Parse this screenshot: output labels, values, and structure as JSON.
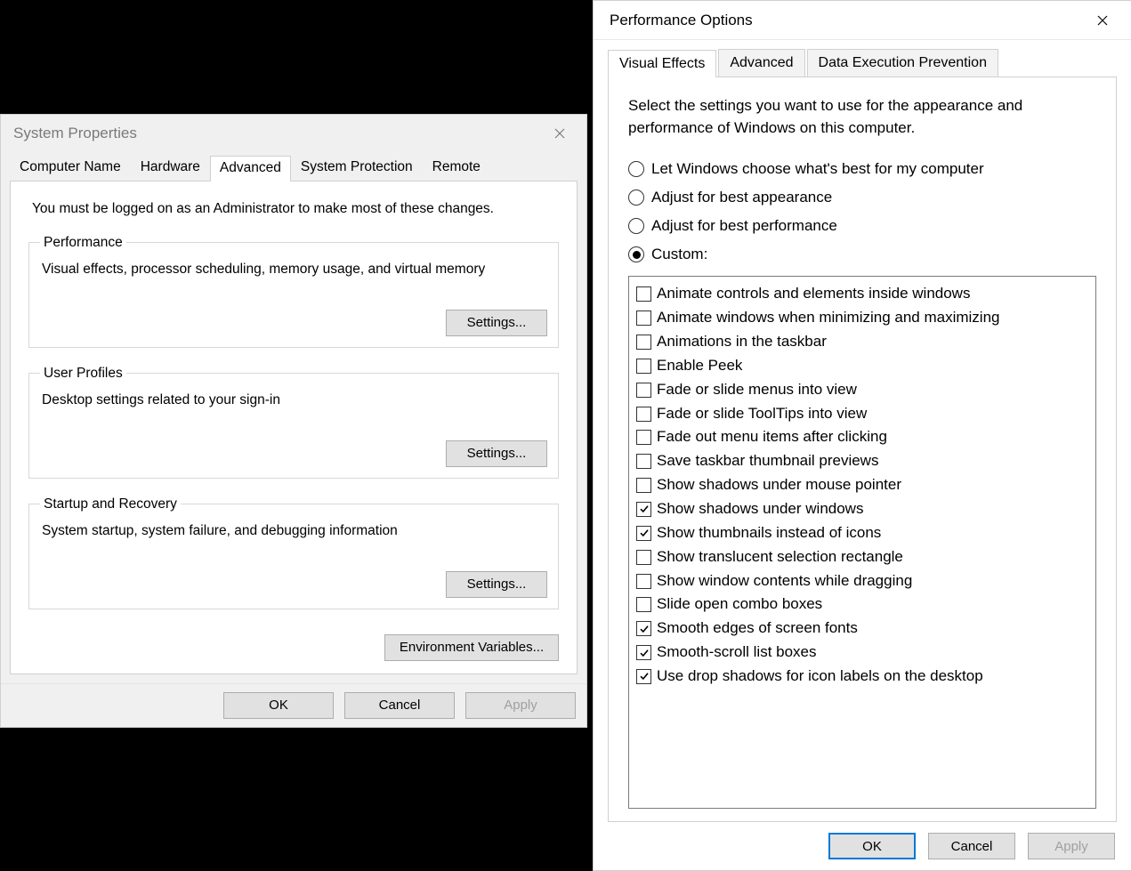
{
  "sysprops": {
    "title": "System Properties",
    "tabs": [
      "Computer Name",
      "Hardware",
      "Advanced",
      "System Protection",
      "Remote"
    ],
    "active_tab": 2,
    "admin_note": "You must be logged on as an Administrator to make most of these changes.",
    "groups": {
      "performance": {
        "legend": "Performance",
        "desc": "Visual effects, processor scheduling, memory usage, and virtual memory",
        "button": "Settings..."
      },
      "user_profiles": {
        "legend": "User Profiles",
        "desc": "Desktop settings related to your sign-in",
        "button": "Settings..."
      },
      "startup": {
        "legend": "Startup and Recovery",
        "desc": "System startup, system failure, and debugging information",
        "button": "Settings..."
      }
    },
    "env_button": "Environment Variables...",
    "buttons": {
      "ok": "OK",
      "cancel": "Cancel",
      "apply": "Apply"
    }
  },
  "perf": {
    "title": "Performance Options",
    "tabs": [
      "Visual Effects",
      "Advanced",
      "Data Execution Prevention"
    ],
    "active_tab": 0,
    "instruction": "Select the settings you want to use for the appearance and performance of Windows on this computer.",
    "radios": [
      {
        "label": "Let Windows choose what's best for my computer",
        "checked": false
      },
      {
        "label": "Adjust for best appearance",
        "checked": false
      },
      {
        "label": "Adjust for best performance",
        "checked": false
      },
      {
        "label": "Custom:",
        "checked": true
      }
    ],
    "checks": [
      {
        "label": "Animate controls and elements inside windows",
        "checked": false
      },
      {
        "label": "Animate windows when minimizing and maximizing",
        "checked": false
      },
      {
        "label": "Animations in the taskbar",
        "checked": false
      },
      {
        "label": "Enable Peek",
        "checked": false
      },
      {
        "label": "Fade or slide menus into view",
        "checked": false
      },
      {
        "label": "Fade or slide ToolTips into view",
        "checked": false
      },
      {
        "label": "Fade out menu items after clicking",
        "checked": false
      },
      {
        "label": "Save taskbar thumbnail previews",
        "checked": false
      },
      {
        "label": "Show shadows under mouse pointer",
        "checked": false
      },
      {
        "label": "Show shadows under windows",
        "checked": true
      },
      {
        "label": "Show thumbnails instead of icons",
        "checked": true
      },
      {
        "label": "Show translucent selection rectangle",
        "checked": false
      },
      {
        "label": "Show window contents while dragging",
        "checked": false
      },
      {
        "label": "Slide open combo boxes",
        "checked": false
      },
      {
        "label": "Smooth edges of screen fonts",
        "checked": true
      },
      {
        "label": "Smooth-scroll list boxes",
        "checked": true
      },
      {
        "label": "Use drop shadows for icon labels on the desktop",
        "checked": true
      }
    ],
    "buttons": {
      "ok": "OK",
      "cancel": "Cancel",
      "apply": "Apply"
    }
  }
}
